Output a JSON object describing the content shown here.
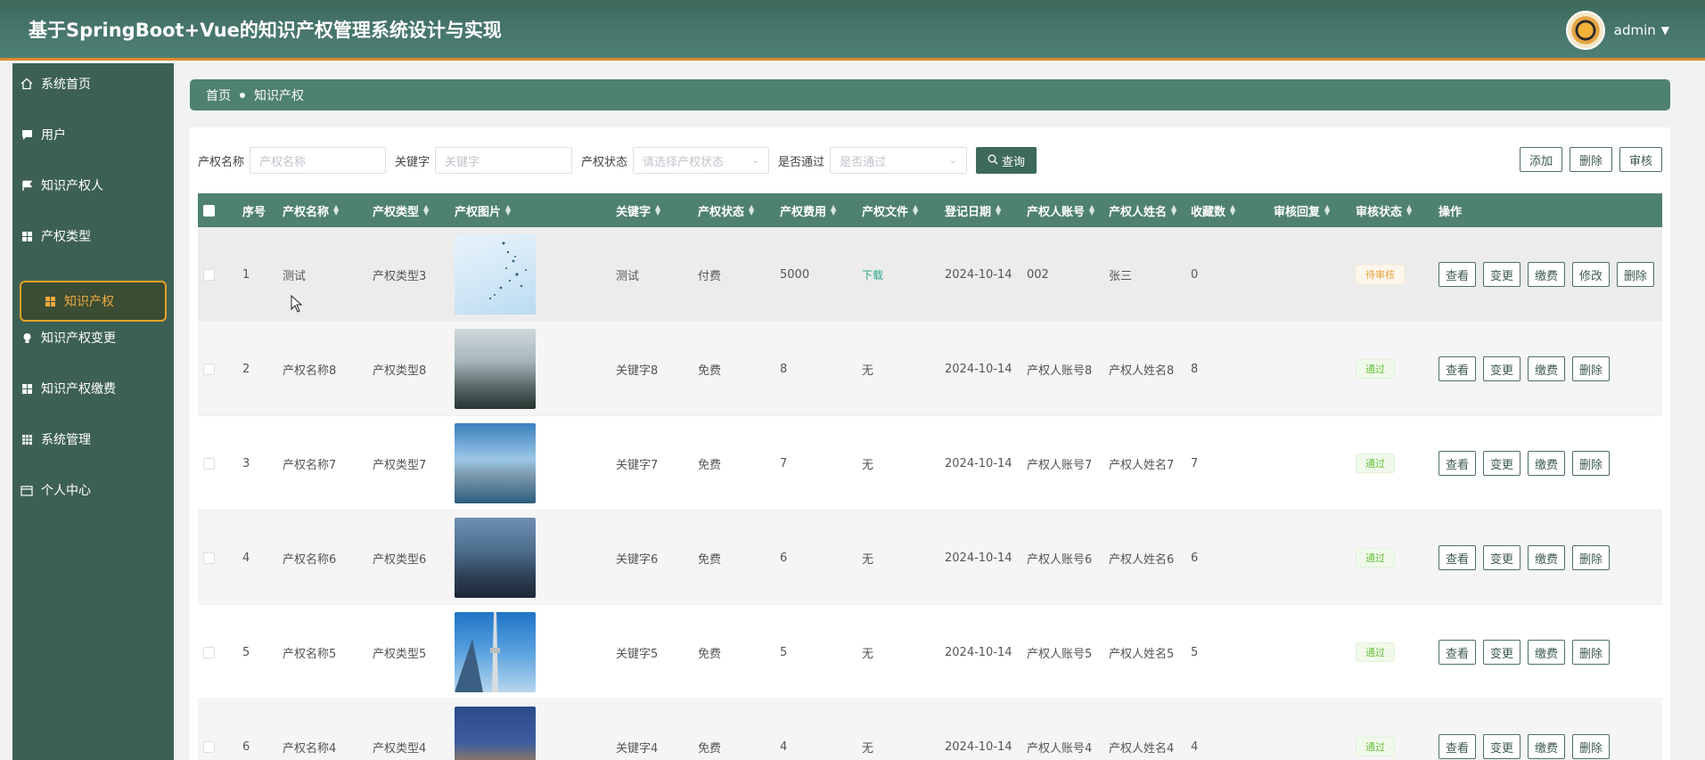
{
  "header": {
    "title": "基于SpringBoot+Vue的知识产权管理系统设计与实现",
    "username": "admin"
  },
  "sidebar": {
    "items": [
      {
        "label": "系统首页",
        "icon": "home-icon"
      },
      {
        "label": "用户",
        "icon": "chat-icon"
      },
      {
        "label": "知识产权人",
        "icon": "flag-icon"
      },
      {
        "label": "产权类型",
        "icon": "grid-icon"
      },
      {
        "label": "知识产权",
        "icon": "grid-icon",
        "active": true
      },
      {
        "label": "知识产权变更",
        "icon": "bulb-icon"
      },
      {
        "label": "知识产权缴费",
        "icon": "grid-icon"
      },
      {
        "label": "系统管理",
        "icon": "table-icon"
      },
      {
        "label": "个人中心",
        "icon": "calendar-icon"
      }
    ]
  },
  "breadcrumb": {
    "home": "首页",
    "current": "知识产权"
  },
  "filter": {
    "name_label": "产权名称",
    "name_placeholder": "产权名称",
    "keyword_label": "关键字",
    "keyword_placeholder": "关键字",
    "status_label": "产权状态",
    "status_placeholder": "请选择产权状态",
    "pass_label": "是否通过",
    "pass_placeholder": "是否通过",
    "query_label": "查询"
  },
  "actions": {
    "add": "添加",
    "delete": "删除",
    "review": "审核"
  },
  "table": {
    "headers": [
      "序号",
      "产权名称",
      "产权类型",
      "产权图片",
      "关键字",
      "产权状态",
      "产权费用",
      "产权文件",
      "登记日期",
      "产权人账号",
      "产权人姓名",
      "收藏数",
      "审核回复",
      "审核状态",
      "操作"
    ],
    "rows": [
      {
        "index": "1",
        "name": "测试",
        "type": "产权类型3",
        "keyword": "测试",
        "status": "付费",
        "fee": "5000",
        "file": "下载",
        "date": "2024-10-14",
        "account": "002",
        "owner": "张三",
        "favorites": "0",
        "reply": "",
        "review": "待审核"
      },
      {
        "index": "2",
        "name": "产权名称8",
        "type": "产权类型8",
        "keyword": "关键字8",
        "status": "免费",
        "fee": "8",
        "file": "无",
        "date": "2024-10-14",
        "account": "产权人账号8",
        "owner": "产权人姓名8",
        "favorites": "8",
        "reply": "",
        "review": "通过"
      },
      {
        "index": "3",
        "name": "产权名称7",
        "type": "产权类型7",
        "keyword": "关键字7",
        "status": "免费",
        "fee": "7",
        "file": "无",
        "date": "2024-10-14",
        "account": "产权人账号7",
        "owner": "产权人姓名7",
        "favorites": "7",
        "reply": "",
        "review": "通过"
      },
      {
        "index": "4",
        "name": "产权名称6",
        "type": "产权类型6",
        "keyword": "关键字6",
        "status": "免费",
        "fee": "6",
        "file": "无",
        "date": "2024-10-14",
        "account": "产权人账号6",
        "owner": "产权人姓名6",
        "favorites": "6",
        "reply": "",
        "review": "通过"
      },
      {
        "index": "5",
        "name": "产权名称5",
        "type": "产权类型5",
        "keyword": "关键字5",
        "status": "免费",
        "fee": "5",
        "file": "无",
        "date": "2024-10-14",
        "account": "产权人账号5",
        "owner": "产权人姓名5",
        "favorites": "5",
        "reply": "",
        "review": "通过"
      },
      {
        "index": "6",
        "name": "产权名称4",
        "type": "产权类型4",
        "keyword": "关键字4",
        "status": "免费",
        "fee": "4",
        "file": "无",
        "date": "2024-10-14",
        "account": "产权人账号4",
        "owner": "产权人姓名4",
        "favorites": "4",
        "reply": "",
        "review": "通过"
      }
    ],
    "ops": {
      "view": "查看",
      "change": "变更",
      "pay": "缴费",
      "edit": "修改",
      "delete": "删除"
    }
  },
  "colors": {
    "header": "#4e8077",
    "sidebar": "#3d6055",
    "accent": "#e8a125",
    "table_header": "#4f8170"
  }
}
